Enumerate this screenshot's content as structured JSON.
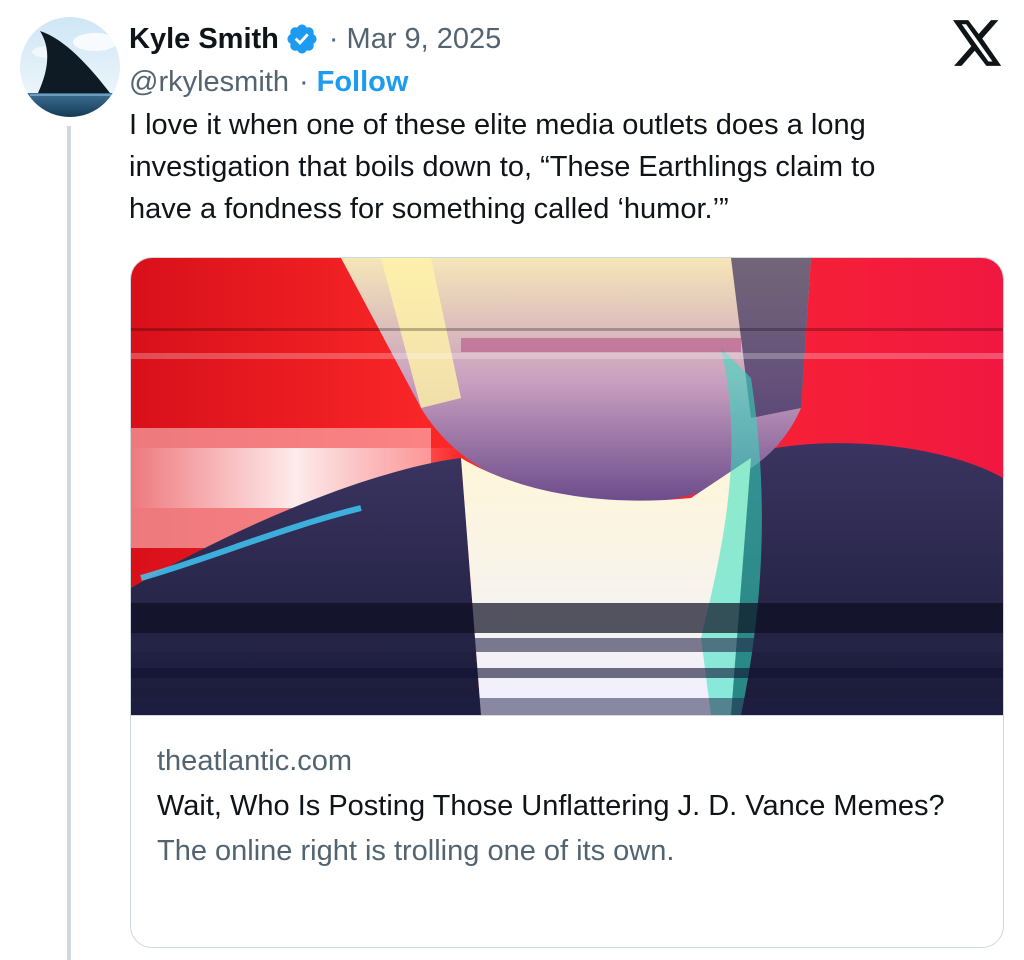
{
  "author": {
    "name": "Kyle Smith",
    "verified_icon": "verified-badge-icon",
    "handle": "@rkylesmith",
    "separator": "·",
    "follow_label": "Follow"
  },
  "tweet": {
    "date": "Mar 9, 2025",
    "text_lines": [
      "I love it when one of these elite media outlets does a long",
      "investigation that boils down to, “These Earthlings claim to",
      "have a fondness for something called ‘humor.’”"
    ]
  },
  "card": {
    "domain": "theatlantic.com",
    "title": "Wait, Who Is Posting Those Unflattering J. D. Vance Memes?",
    "description": "The online right is trolling one of its own."
  },
  "colors": {
    "accent": "#1d9bf0",
    "secondary_text": "#536471",
    "border": "#cfd9de"
  },
  "icons": {
    "platform_logo": "x-logo-icon",
    "avatar": "shark-fin-avatar"
  }
}
